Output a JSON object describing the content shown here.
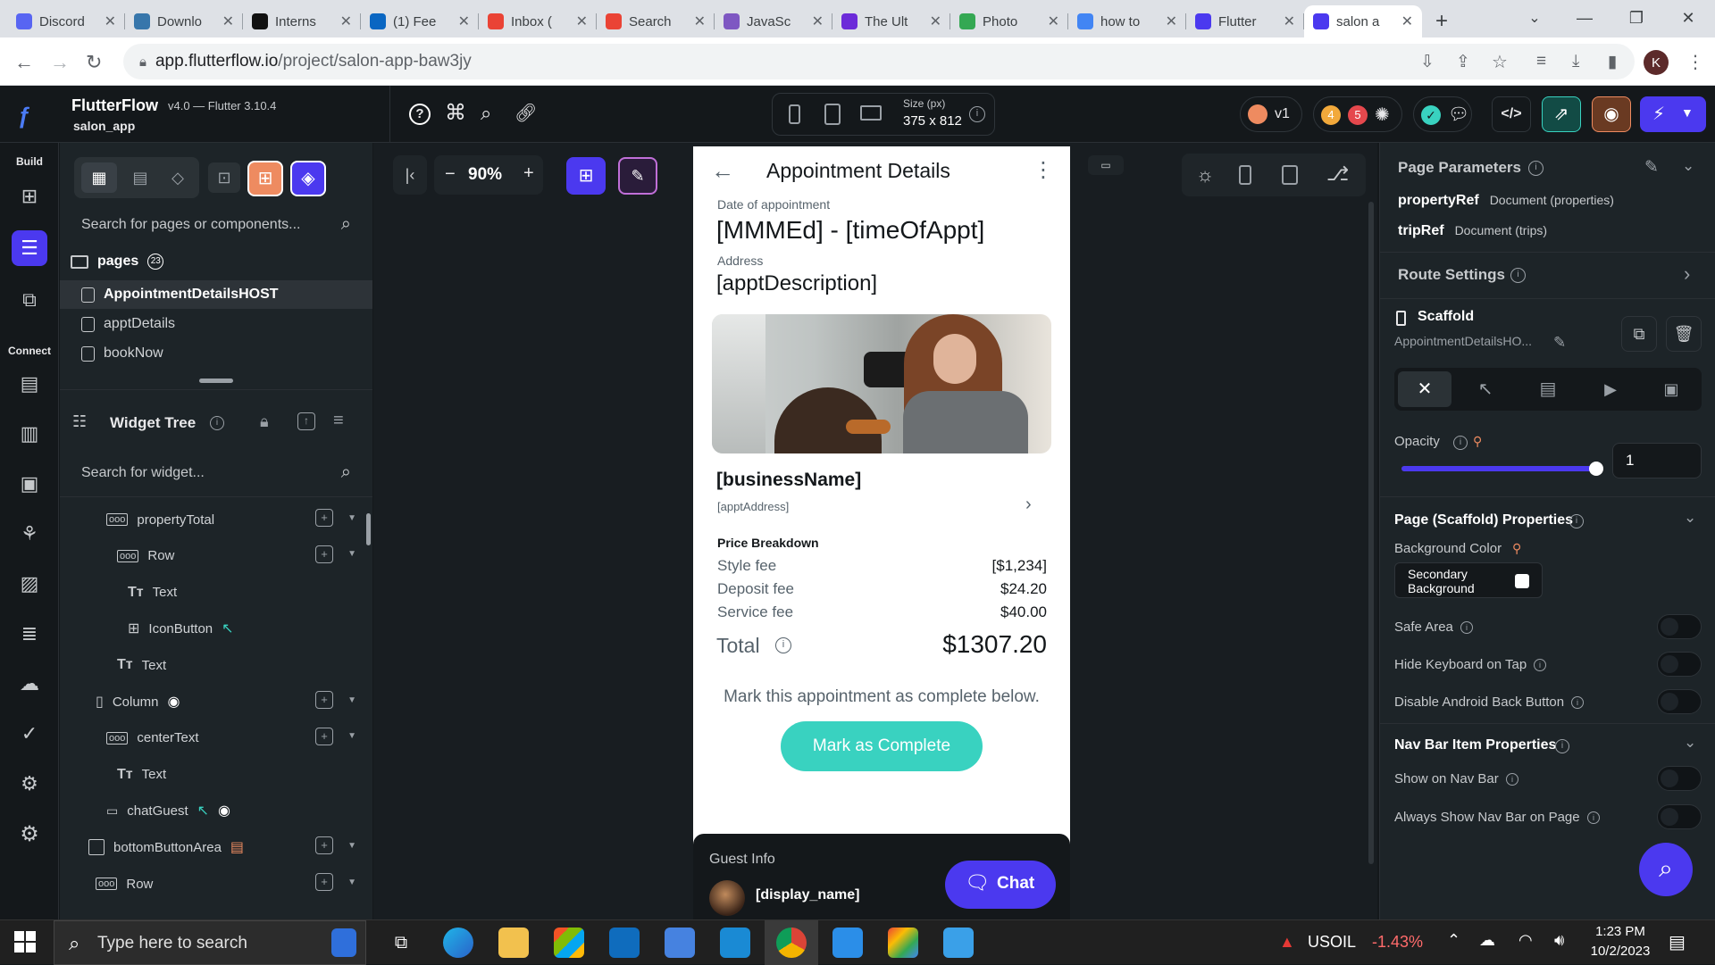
{
  "browser": {
    "tabs": [
      {
        "label": "Discord",
        "color": "#5865f2"
      },
      {
        "label": "Downlo",
        "color": "#3776ab"
      },
      {
        "label": "Interns",
        "color": "#111111"
      },
      {
        "label": "(1) Fee",
        "color": "#0a66c2"
      },
      {
        "label": "Inbox (",
        "color": "#ea4335"
      },
      {
        "label": "Search",
        "color": "#ea4335"
      },
      {
        "label": "JavaSc",
        "color": "#7e57c2"
      },
      {
        "label": "The Ult",
        "color": "#6c2bd9"
      },
      {
        "label": "Photo",
        "color": "#34a853"
      },
      {
        "label": "how to",
        "color": "#4285f4"
      },
      {
        "label": "Flutter",
        "color": "#4b39ef"
      },
      {
        "label": "salon a",
        "color": "#4b39ef"
      }
    ],
    "url_host": "app.flutterflow.io",
    "url_path": "/project/salon-app-baw3jy",
    "profile_initial": "K"
  },
  "app": {
    "name": "FlutterFlow",
    "version": "v4.0 — Flutter 3.10.4",
    "project": "salon_app",
    "size_label": "Size (px)",
    "size_value": "375 x 812",
    "version_badge": "v1",
    "notif_count_1": "4",
    "notif_count_2": "5",
    "zoom": "90%"
  },
  "rail": {
    "build_label": "Build",
    "connect_label": "Connect"
  },
  "pages": {
    "search_placeholder": "Search for pages or components...",
    "header": "pages",
    "count": "23",
    "items": [
      "AppointmentDetailsHOST",
      "apptDetails",
      "bookNow"
    ]
  },
  "widget_tree": {
    "title": "Widget Tree",
    "search_placeholder": "Search for widget...",
    "nodes": [
      {
        "label": "propertyTotal"
      },
      {
        "label": "Row"
      },
      {
        "label": "Text"
      },
      {
        "label": "IconButton"
      },
      {
        "label": "Text"
      },
      {
        "label": "Column"
      },
      {
        "label": "centerText"
      },
      {
        "label": "Text"
      },
      {
        "label": "chatGuest"
      },
      {
        "label": "bottomButtonArea"
      },
      {
        "label": "Row"
      }
    ]
  },
  "phone": {
    "title": "Appointment Details",
    "date_label": "Date of appointment",
    "date_value": "[MMMEd] - [timeOfAppt]",
    "address_label": "Address",
    "address_value": "[apptDescription]",
    "business_name": "[businessName]",
    "business_address": "[apptAddress]",
    "price_header": "Price Breakdown",
    "fees": [
      {
        "label": "Style fee",
        "value": "[$1,234]"
      },
      {
        "label": "Deposit fee",
        "value": "$24.20"
      },
      {
        "label": "Service fee",
        "value": "$40.00"
      }
    ],
    "total_label": "Total",
    "total_value": "$1307.20",
    "complete_hint": "Mark this appointment as complete below.",
    "complete_button": "Mark as Complete",
    "guest_label": "Guest Info",
    "guest_name": "[display_name]",
    "chat_button": "Chat"
  },
  "props": {
    "page_params_title": "Page Parameters",
    "params": [
      {
        "name": "propertyRef",
        "type": "Document (properties)"
      },
      {
        "name": "tripRef",
        "type": "Document (trips)"
      }
    ],
    "route_settings": "Route Settings",
    "widget_type": "Scaffold",
    "widget_name": "AppointmentDetailsHO...",
    "opacity_label": "Opacity",
    "opacity_value": "1",
    "opacity_fraction": 1.0,
    "scaffold_props_title": "Page (Scaffold) Properties",
    "bg_color_label": "Background Color",
    "bg_color_value": "Secondary Background",
    "toggles": [
      "Safe Area",
      "Hide Keyboard on Tap",
      "Disable Android Back Button"
    ],
    "nav_title": "Nav Bar Item Properties",
    "nav_toggles": [
      "Show on Nav Bar",
      "Always Show Nav Bar on Page"
    ]
  },
  "taskbar": {
    "search_placeholder": "Type here to search",
    "ticker_name": "USOIL",
    "ticker_change": "-1.43%",
    "time": "1:23 PM",
    "date": "10/2/2023"
  },
  "colors": {
    "accent": "#4b39ef",
    "teal": "#39d2c0",
    "orange": "#ee8b60"
  }
}
